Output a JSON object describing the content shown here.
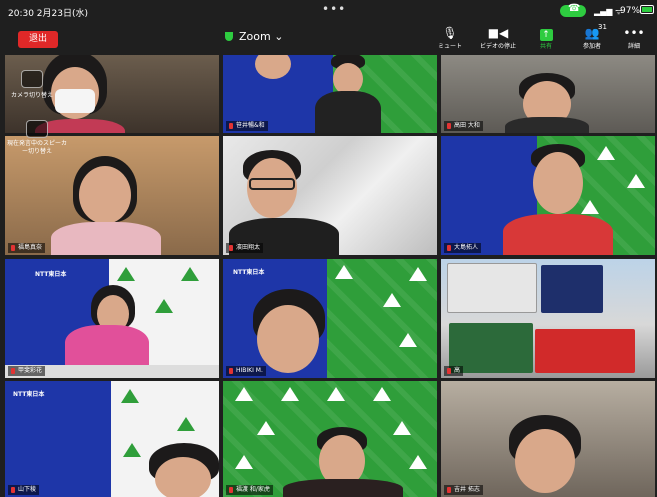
{
  "status_bar": {
    "time": "20:30 2月23日(水)",
    "dots": "•••",
    "battery": "97%"
  },
  "toolbar": {
    "leave": "退出",
    "title": "Zoom",
    "mute": "ミュート",
    "stop_video": "ビデオの停止",
    "share": "共有",
    "participants": "参加者",
    "participants_count": "31",
    "more": "詳細"
  },
  "overlay": {
    "switch_camera": "カメラ切り替え",
    "switch_speaker": "現在発言中のスピーカー切り替え"
  },
  "participants": [
    {
      "name": ""
    },
    {
      "name": "笹井暢&和"
    },
    {
      "name": "高田 大和"
    },
    {
      "name": "福島真奈"
    },
    {
      "name": "濱田翔太"
    },
    {
      "name": "大島拓人"
    },
    {
      "name": "甲斐彩花"
    },
    {
      "name": "HIBIKI M."
    },
    {
      "name": "高"
    },
    {
      "name": "山下稜"
    },
    {
      "name": "福渡 和/家虎"
    },
    {
      "name": "吉井 拓志"
    }
  ],
  "colors": {
    "leave": "#e02828",
    "share": "#2ecc40",
    "background_green": "#2f9e3a",
    "background_blue": "#1e36a8"
  }
}
